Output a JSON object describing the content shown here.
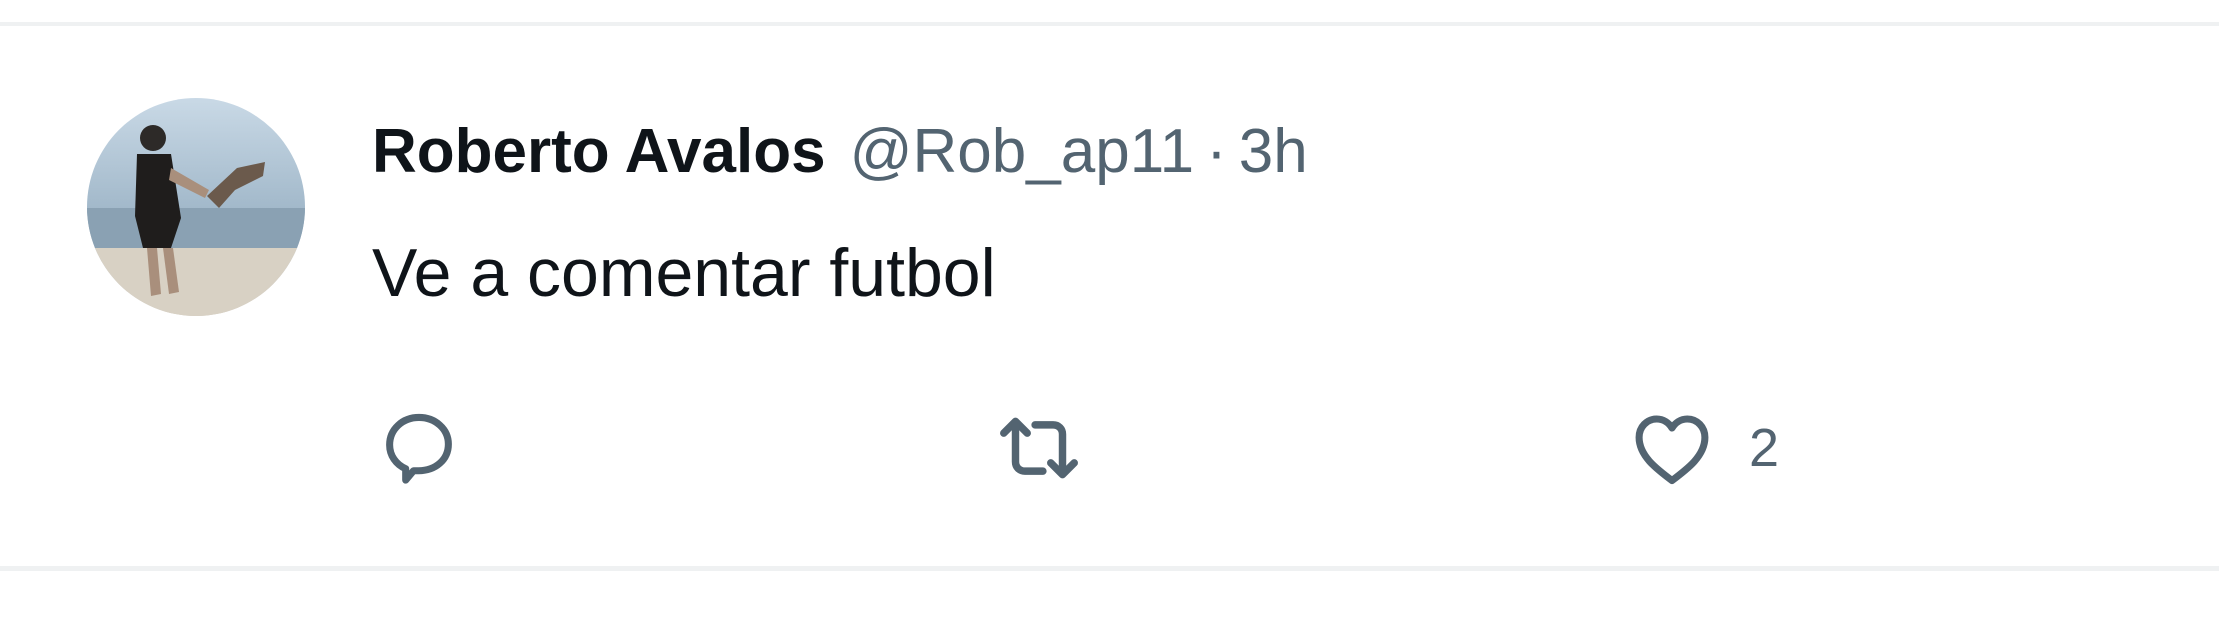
{
  "post": {
    "author": {
      "display_name": "Roberto Avalos",
      "handle": "@Rob_ap11",
      "avatar_icon": "user-photo-avatar"
    },
    "separator": "·",
    "timestamp": "3h",
    "text": "Ve a comentar futbol",
    "actions": {
      "reply": {
        "icon": "reply-icon",
        "count": ""
      },
      "repost": {
        "icon": "repost-icon",
        "count": ""
      },
      "like": {
        "icon": "heart-icon",
        "count": "2"
      }
    }
  },
  "colors": {
    "primary_text": "#0f1419",
    "secondary_text": "#536471",
    "divider": "#eff1f2",
    "background": "#ffffff"
  }
}
